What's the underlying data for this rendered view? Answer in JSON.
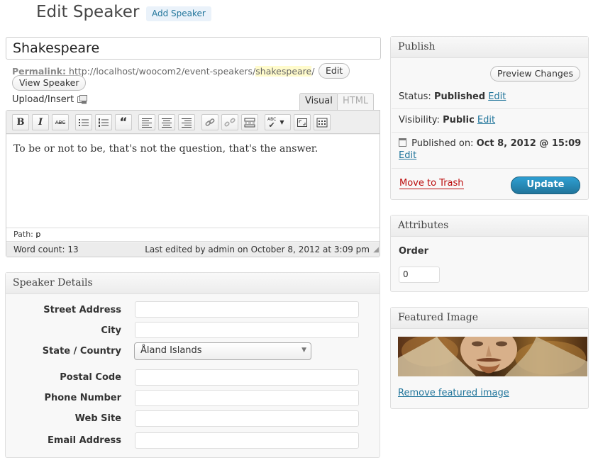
{
  "header": {
    "title": "Edit Speaker",
    "add_new_label": "Add Speaker"
  },
  "post": {
    "title_value": "Shakespeare",
    "permalink_label": "Permalink:",
    "permalink_base": "http://localhost/woocom2/event-speakers/",
    "permalink_slug": "shakespeare",
    "permalink_tail": "/",
    "edit_slug_label": "Edit",
    "view_label": "View Speaker"
  },
  "editor": {
    "upload_label": "Upload/Insert",
    "tabs": {
      "visual": "Visual",
      "html": "HTML"
    },
    "toolbar": [
      "bold",
      "italic",
      "strikethrough",
      "bullet-list",
      "numbered-list",
      "blockquote",
      "align-left",
      "align-center",
      "align-right",
      "insert-link",
      "unlink",
      "insert-more",
      "spellcheck",
      "fullscreen",
      "kitchen-sink"
    ],
    "toolbar_glyphs": {
      "bold": "B",
      "italic": "I",
      "strikethrough": "ABC",
      "spellcheck": "ABC"
    },
    "content": "To be or not to be, that's not the question, that's the answer.",
    "path_label": "Path:",
    "path_value": "p",
    "word_count": "Word count: 13",
    "last_edited": "Last edited by admin on October 8, 2012 at 3:09 pm"
  },
  "speaker_details": {
    "title": "Speaker Details",
    "fields": {
      "street": "Street Address",
      "city": "City",
      "state_country": "State / Country",
      "postal": "Postal Code",
      "phone": "Phone Number",
      "website": "Web Site",
      "email": "Email Address"
    },
    "country_selected": "Åland Islands"
  },
  "publish": {
    "title": "Publish",
    "preview_label": "Preview Changes",
    "status_label": "Status:",
    "status_value": "Published",
    "visibility_label": "Visibility:",
    "visibility_value": "Public",
    "published_on_label": "Published on:",
    "published_on_value": "Oct 8, 2012 @ 15:09",
    "edit_label": "Edit",
    "trash_label": "Move to Trash",
    "update_label": "Update"
  },
  "attributes": {
    "title": "Attributes",
    "order_label": "Order",
    "order_value": "0"
  },
  "featured_image": {
    "title": "Featured Image",
    "remove_label": "Remove featured image"
  },
  "colors": {
    "link": "#21759b",
    "trash": "#bc0b0b",
    "button": "#21759b",
    "slug_highlight": "#fffbcc"
  }
}
